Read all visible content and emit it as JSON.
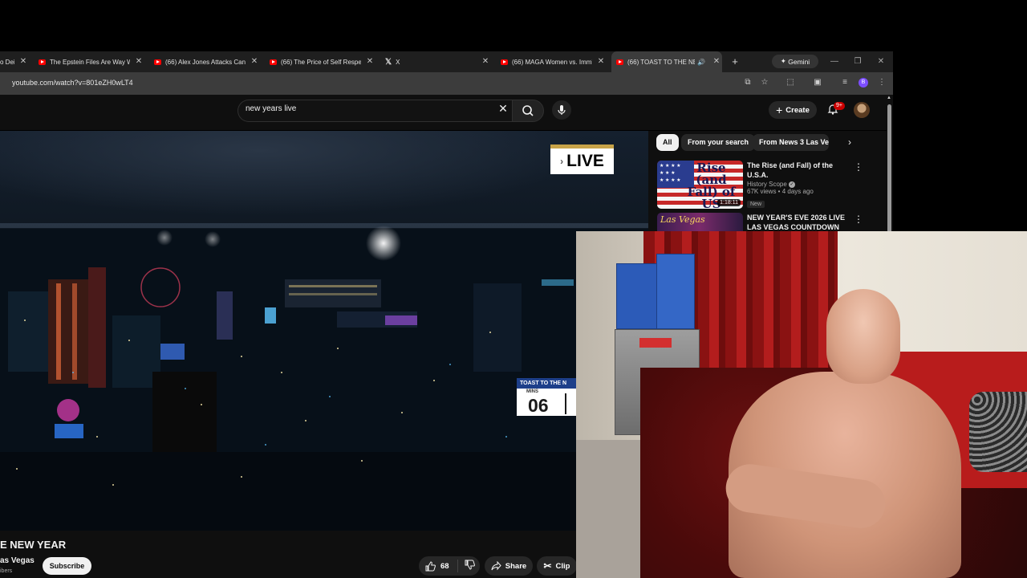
{
  "browser": {
    "tabs": [
      {
        "title": "o Dei",
        "type": "partial"
      },
      {
        "title": "The Epstein Files Are Way Wo",
        "type": "youtube"
      },
      {
        "title": "(66) Alex Jones Attacks Candi",
        "type": "youtube"
      },
      {
        "title": "(66) The Price of Self Respec",
        "type": "youtube"
      },
      {
        "title": "X",
        "type": "x"
      },
      {
        "title": "(66) MAGA Women vs. Immig",
        "type": "youtube"
      },
      {
        "title": "(66) TOAST TO THE NEW",
        "type": "youtube",
        "active": true,
        "audio": true
      }
    ],
    "gemini_label": "Gemini",
    "new_tab": "+",
    "url": "youtube.com/watch?v=801eZH0wLT4",
    "profile_letter": "B"
  },
  "youtube": {
    "search_query": "new years live",
    "create_label": "Create",
    "notification_count": "9+"
  },
  "video": {
    "live_label": "LIVE",
    "ticker": {
      "title": "TOAST TO THE N",
      "unit": "MINS",
      "value": "06"
    },
    "title": "E NEW YEAR",
    "channel": "as Vegas",
    "subscribers": "ibers",
    "subscribe_label": "Subscribe",
    "likes": "68",
    "share_label": "Share",
    "clip_label": "Clip"
  },
  "sidebar": {
    "chips": [
      {
        "label": "All",
        "active": true
      },
      {
        "label": "From your search",
        "active": false
      },
      {
        "label": "From News 3 Las Vegas",
        "active": false
      }
    ],
    "videos": [
      {
        "thumb_text": "Rise (and Fall) of US hegemony",
        "duration": "1:18:11",
        "title": "The Rise (and Fall) of the U.S.A.",
        "channel": "History Scope",
        "verified": true,
        "stats": "67K views • 4 days ago",
        "badge": "New"
      },
      {
        "thumb_text": "Las Vegas",
        "title": "NEW YEAR'S EVE 2026 LIVE LAS VEGAS COUNTDOWN"
      }
    ]
  },
  "colors": {
    "youtube_bg": "#0f0f0f",
    "youtube_red": "#ff0000",
    "chip_bg": "#272727",
    "live_badge_accent": "#c8a348",
    "ticker_blue": "#1d3f8a"
  },
  "icons": [
    "youtube-favicon",
    "x-favicon",
    "gemini-icon",
    "search-icon",
    "mic-icon",
    "bell-icon",
    "thumbs-up-icon",
    "thumbs-down-icon",
    "share-icon",
    "scissors-icon",
    "kebab-icon"
  ]
}
